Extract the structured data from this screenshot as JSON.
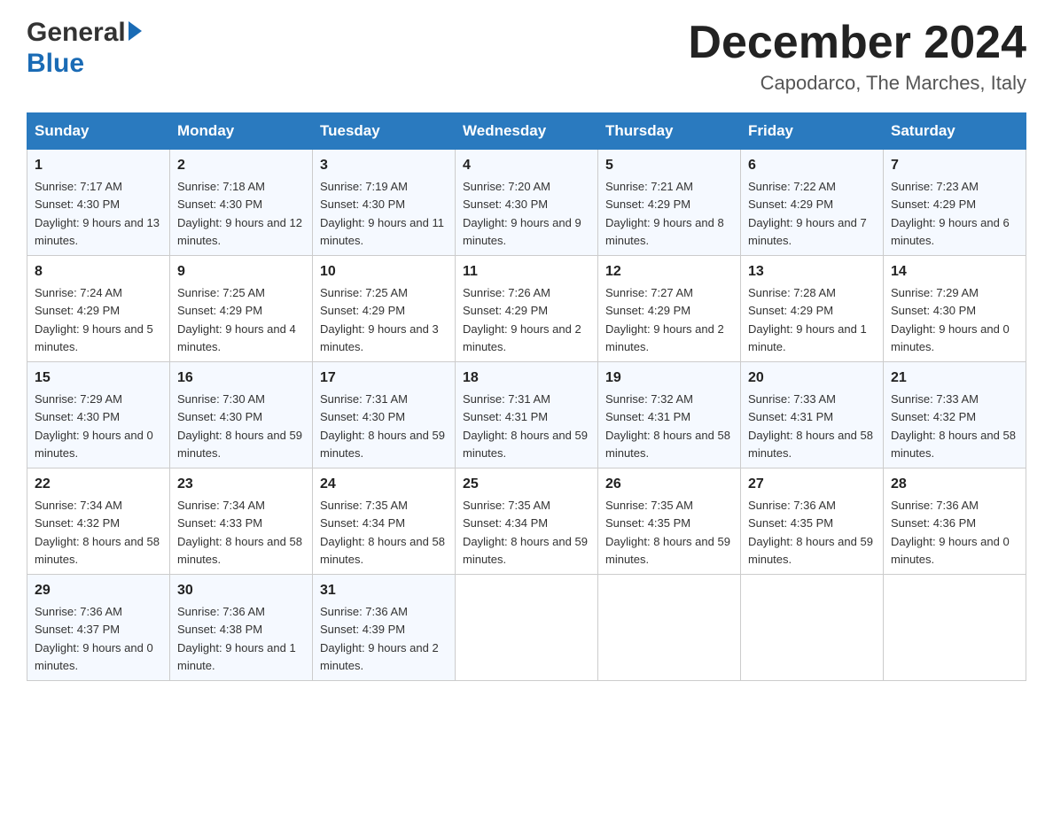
{
  "header": {
    "logo_general": "General",
    "logo_blue": "Blue",
    "month_title": "December 2024",
    "location": "Capodarco, The Marches, Italy"
  },
  "days_of_week": [
    "Sunday",
    "Monday",
    "Tuesday",
    "Wednesday",
    "Thursday",
    "Friday",
    "Saturday"
  ],
  "weeks": [
    [
      {
        "day": "1",
        "sunrise": "7:17 AM",
        "sunset": "4:30 PM",
        "daylight": "9 hours and 13 minutes."
      },
      {
        "day": "2",
        "sunrise": "7:18 AM",
        "sunset": "4:30 PM",
        "daylight": "9 hours and 12 minutes."
      },
      {
        "day": "3",
        "sunrise": "7:19 AM",
        "sunset": "4:30 PM",
        "daylight": "9 hours and 11 minutes."
      },
      {
        "day": "4",
        "sunrise": "7:20 AM",
        "sunset": "4:30 PM",
        "daylight": "9 hours and 9 minutes."
      },
      {
        "day": "5",
        "sunrise": "7:21 AM",
        "sunset": "4:29 PM",
        "daylight": "9 hours and 8 minutes."
      },
      {
        "day": "6",
        "sunrise": "7:22 AM",
        "sunset": "4:29 PM",
        "daylight": "9 hours and 7 minutes."
      },
      {
        "day": "7",
        "sunrise": "7:23 AM",
        "sunset": "4:29 PM",
        "daylight": "9 hours and 6 minutes."
      }
    ],
    [
      {
        "day": "8",
        "sunrise": "7:24 AM",
        "sunset": "4:29 PM",
        "daylight": "9 hours and 5 minutes."
      },
      {
        "day": "9",
        "sunrise": "7:25 AM",
        "sunset": "4:29 PM",
        "daylight": "9 hours and 4 minutes."
      },
      {
        "day": "10",
        "sunrise": "7:25 AM",
        "sunset": "4:29 PM",
        "daylight": "9 hours and 3 minutes."
      },
      {
        "day": "11",
        "sunrise": "7:26 AM",
        "sunset": "4:29 PM",
        "daylight": "9 hours and 2 minutes."
      },
      {
        "day": "12",
        "sunrise": "7:27 AM",
        "sunset": "4:29 PM",
        "daylight": "9 hours and 2 minutes."
      },
      {
        "day": "13",
        "sunrise": "7:28 AM",
        "sunset": "4:29 PM",
        "daylight": "9 hours and 1 minute."
      },
      {
        "day": "14",
        "sunrise": "7:29 AM",
        "sunset": "4:30 PM",
        "daylight": "9 hours and 0 minutes."
      }
    ],
    [
      {
        "day": "15",
        "sunrise": "7:29 AM",
        "sunset": "4:30 PM",
        "daylight": "9 hours and 0 minutes."
      },
      {
        "day": "16",
        "sunrise": "7:30 AM",
        "sunset": "4:30 PM",
        "daylight": "8 hours and 59 minutes."
      },
      {
        "day": "17",
        "sunrise": "7:31 AM",
        "sunset": "4:30 PM",
        "daylight": "8 hours and 59 minutes."
      },
      {
        "day": "18",
        "sunrise": "7:31 AM",
        "sunset": "4:31 PM",
        "daylight": "8 hours and 59 minutes."
      },
      {
        "day": "19",
        "sunrise": "7:32 AM",
        "sunset": "4:31 PM",
        "daylight": "8 hours and 58 minutes."
      },
      {
        "day": "20",
        "sunrise": "7:33 AM",
        "sunset": "4:31 PM",
        "daylight": "8 hours and 58 minutes."
      },
      {
        "day": "21",
        "sunrise": "7:33 AM",
        "sunset": "4:32 PM",
        "daylight": "8 hours and 58 minutes."
      }
    ],
    [
      {
        "day": "22",
        "sunrise": "7:34 AM",
        "sunset": "4:32 PM",
        "daylight": "8 hours and 58 minutes."
      },
      {
        "day": "23",
        "sunrise": "7:34 AM",
        "sunset": "4:33 PM",
        "daylight": "8 hours and 58 minutes."
      },
      {
        "day": "24",
        "sunrise": "7:35 AM",
        "sunset": "4:34 PM",
        "daylight": "8 hours and 58 minutes."
      },
      {
        "day": "25",
        "sunrise": "7:35 AM",
        "sunset": "4:34 PM",
        "daylight": "8 hours and 59 minutes."
      },
      {
        "day": "26",
        "sunrise": "7:35 AM",
        "sunset": "4:35 PM",
        "daylight": "8 hours and 59 minutes."
      },
      {
        "day": "27",
        "sunrise": "7:36 AM",
        "sunset": "4:35 PM",
        "daylight": "8 hours and 59 minutes."
      },
      {
        "day": "28",
        "sunrise": "7:36 AM",
        "sunset": "4:36 PM",
        "daylight": "9 hours and 0 minutes."
      }
    ],
    [
      {
        "day": "29",
        "sunrise": "7:36 AM",
        "sunset": "4:37 PM",
        "daylight": "9 hours and 0 minutes."
      },
      {
        "day": "30",
        "sunrise": "7:36 AM",
        "sunset": "4:38 PM",
        "daylight": "9 hours and 1 minute."
      },
      {
        "day": "31",
        "sunrise": "7:36 AM",
        "sunset": "4:39 PM",
        "daylight": "9 hours and 2 minutes."
      },
      null,
      null,
      null,
      null
    ]
  ],
  "labels": {
    "sunrise": "Sunrise:",
    "sunset": "Sunset:",
    "daylight": "Daylight:"
  }
}
